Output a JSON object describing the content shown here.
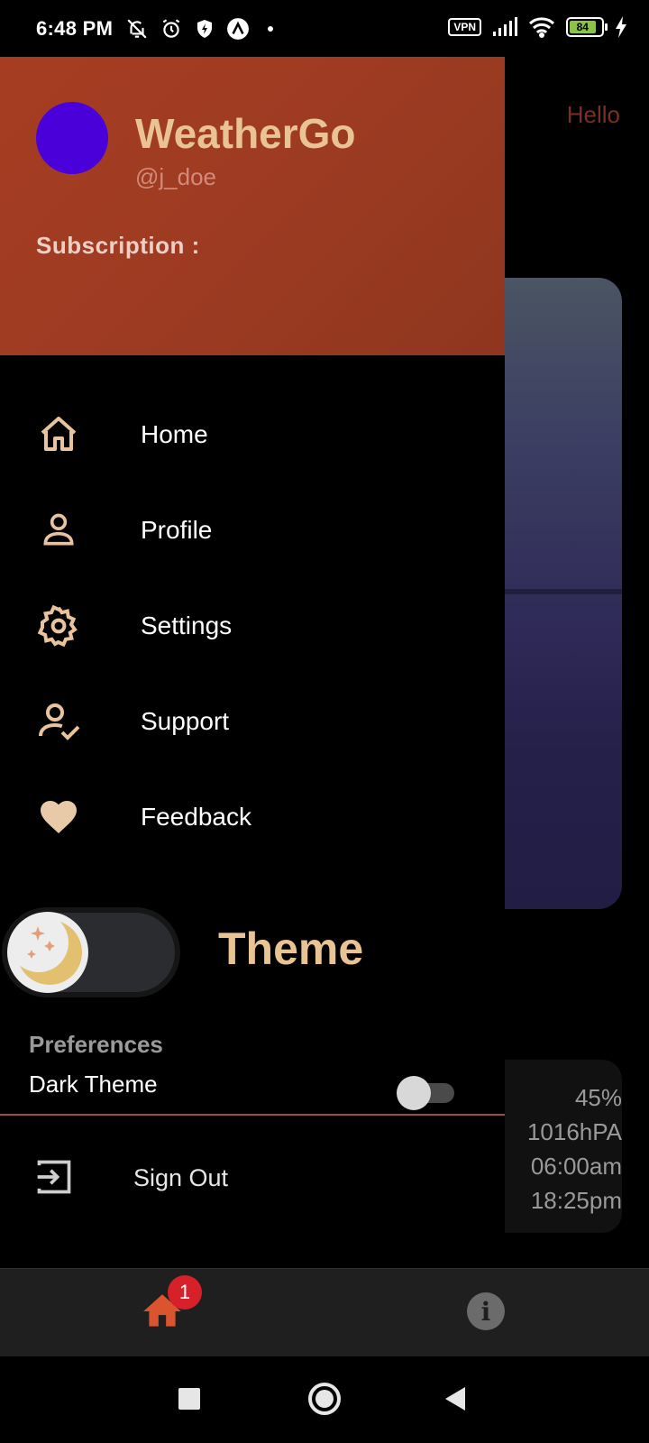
{
  "status_bar": {
    "time": "6:48 PM",
    "vpn": "VPN",
    "battery": "84"
  },
  "background": {
    "greeting": "Hello",
    "stats": [
      "45%",
      "1016hPA",
      "06:00am",
      "18:25pm"
    ]
  },
  "drawer": {
    "app_name": "WeatherGo",
    "username": "@j_doe",
    "subscription_label": "Subscription :",
    "avatar_color": "#4a00d8",
    "header_color": "#a63d22",
    "menu": [
      {
        "label": "Home",
        "icon": "home-icon"
      },
      {
        "label": "Profile",
        "icon": "profile-icon"
      },
      {
        "label": "Settings",
        "icon": "gear-icon"
      },
      {
        "label": "Support",
        "icon": "support-icon"
      },
      {
        "label": "Feedback",
        "icon": "heart-icon"
      }
    ],
    "theme_label": "Theme",
    "preferences_label": "Preferences",
    "dark_theme_label": "Dark Theme",
    "dark_theme_enabled": false,
    "sign_out_label": "Sign Out"
  },
  "bottom_nav": {
    "home_badge": "1",
    "info_label": "i"
  }
}
